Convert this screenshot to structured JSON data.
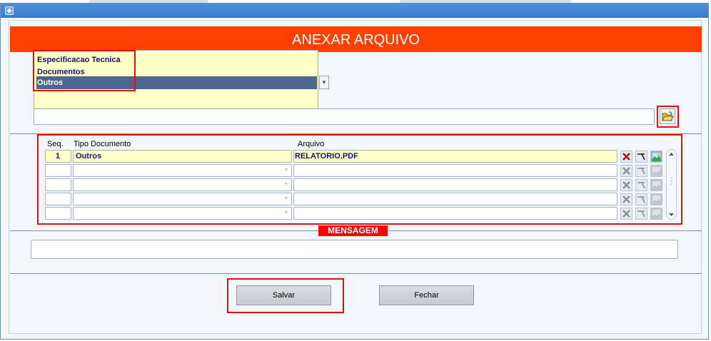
{
  "window": {
    "icon": "app-icon"
  },
  "header": {
    "title": "ANEXAR ARQUIVO"
  },
  "doc_type_dropdown": {
    "options": [
      "Especificacao Tecnica",
      "Documentos",
      "Outros"
    ],
    "selected": "Outros"
  },
  "grid": {
    "columns": {
      "seq": "Seq.",
      "tipo": "Tipo Documento",
      "arquivo": "Arquivo"
    },
    "rows": [
      {
        "seq": "1",
        "tipo": "Outros",
        "arquivo": "RELATORIO.PDF"
      },
      {
        "seq": "",
        "tipo": "",
        "arquivo": ""
      },
      {
        "seq": "",
        "tipo": "",
        "arquivo": ""
      },
      {
        "seq": "",
        "tipo": "",
        "arquivo": ""
      },
      {
        "seq": "",
        "tipo": "",
        "arquivo": ""
      }
    ]
  },
  "message": {
    "label": "MENSAGEM",
    "value": ""
  },
  "buttons": {
    "save": "Salvar",
    "close": "Fechar"
  },
  "colors": {
    "header": "#ff4000",
    "highlight": "#e01010",
    "field_yellow": "#ffffc6",
    "selected_row": "#4d6591"
  }
}
